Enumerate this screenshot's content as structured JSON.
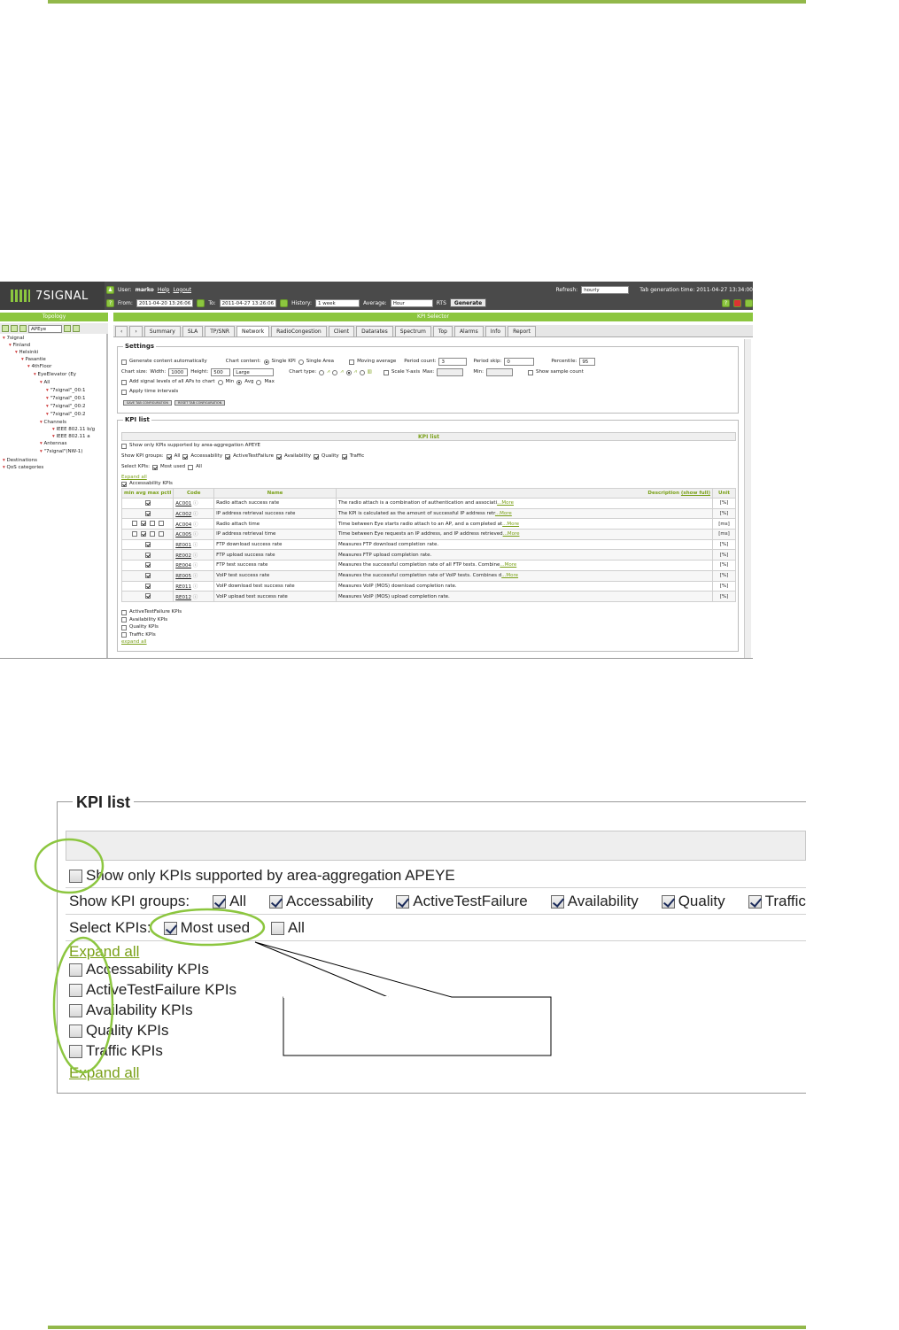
{
  "app": {
    "brand": "7SIGNAL",
    "user_label": "User:",
    "user_name": "marko",
    "help": "Help",
    "logout": "Logout",
    "refresh_label": "Refresh:",
    "refresh_value": "hourly",
    "tab_gen_time": "Tab generation time: 2011-04-27 13:34:00",
    "from_label": "From:",
    "from_value": "2011-04-20 13:26:06",
    "to_label": "To:",
    "to_value": "2011-04-27 13:26:06",
    "history_label": "History:",
    "history_value": "1 week",
    "average_label": "Average:",
    "average_value": "Hour",
    "rts": "RTS",
    "generate": "Generate"
  },
  "topology": {
    "title": "Topology",
    "dropdown": "APEye",
    "nodes": [
      "7signal",
      "Finland",
      "Helsinki",
      "Pasantie",
      "4thFloor",
      "EyeElevator (Ey",
      "All",
      "\"7signal\"_00:1",
      "\"7signal\"_00:1",
      "\"7signal\"_00:2",
      "\"7signal\"_00:2",
      "Channels",
      "IEEE 802.11 b/g",
      "IEEE 802.11 a",
      "Antennas",
      "\"7signal\"(NW-1)",
      "Destinations",
      "QoS categories"
    ]
  },
  "kpi_selector": {
    "title": "KPI Selector",
    "tabs": [
      "Summary",
      "SLA",
      "TP/SNR",
      "Network",
      "RadioCongestion",
      "Client",
      "Datarates",
      "Spectrum",
      "Top",
      "Alarms",
      "Info",
      "Report"
    ],
    "active_tab": "Network"
  },
  "settings": {
    "legend": "Settings",
    "generate_auto": "Generate content automatically",
    "chart_content": "Chart content:",
    "single_kpi": "Single KPI",
    "single_area": "Single Area",
    "moving_avg": "Moving average",
    "period_count_label": "Period count:",
    "period_count": "3",
    "period_skip_label": "Period skip:",
    "period_skip": "0",
    "percentile_label": "Percentile:",
    "percentile": "95",
    "chart_size": "Chart size:",
    "width_label": "Width:",
    "width": "1000",
    "height_label": "Height:",
    "height": "500",
    "size": "Large",
    "chart_type": "Chart type:",
    "scale_y": "Scale Y-axis",
    "max_label": "Max:",
    "min_label": "Min:",
    "show_sample": "Show sample count",
    "add_signal": "Add signal levels of all APs to chart",
    "min": "Min",
    "avg": "Avg",
    "max": "Max",
    "apply_time": "Apply time intervals",
    "save_btn": "SAVE TAB CONFIGURATION",
    "reset_btn": "RESET TAB CONFIGURATION"
  },
  "kpi_list": {
    "legend": "KPI list",
    "header": "KPI list",
    "show_only": "Show only KPIs supported by area-aggregation APEYE",
    "groups_label": "Show KPI groups:",
    "groups": [
      "All",
      "Accessability",
      "ActiveTestFailure",
      "Availability",
      "Quality",
      "Traffic"
    ],
    "select_label": "Select KPIs:",
    "most_used": "Most used",
    "all": "All",
    "expand_all": "Expand all",
    "accessability_kpis": "Accessability KPIs",
    "columns": {
      "stats": "min avg max pctl",
      "code": "Code",
      "name": "Name",
      "description": "Description",
      "show_full": "(show full)",
      "unit": "Unit"
    },
    "rows": [
      {
        "code": "AC001",
        "name": "Radio attach success rate",
        "desc": "The radio attach is a combination of authentication and associati",
        "more": "...More",
        "unit": "[%]",
        "boxes": [
          false,
          true,
          false,
          false
        ],
        "single": true
      },
      {
        "code": "AC002",
        "name": "IP address retrieval success rate",
        "desc": "The KPI is calculated as the amount of successful IP address retr",
        "more": "...More",
        "unit": "[%]",
        "single": true
      },
      {
        "code": "AC004",
        "name": "Radio attach time",
        "desc": "Time between Eye starts radio attach to an AP, and a completed at",
        "more": "...More",
        "unit": "[ms]",
        "single": false
      },
      {
        "code": "AC005",
        "name": "IP address retrieval time",
        "desc": "Time between Eye requests an IP address, and IP address retrieved",
        "more": "...More",
        "unit": "[ms]",
        "single": false
      },
      {
        "code": "RE001",
        "name": "FTP download success rate",
        "desc": "Measures FTP download completion rate.",
        "more": "",
        "unit": "[%]",
        "single": true
      },
      {
        "code": "RE002",
        "name": "FTP upload success rate",
        "desc": "Measures FTP upload completion rate.",
        "more": "",
        "unit": "[%]",
        "single": true
      },
      {
        "code": "RE004",
        "name": "FTP test success rate",
        "desc": "Measures the successful completion rate of all FTP tests. Combine",
        "more": "...More",
        "unit": "[%]",
        "single": true
      },
      {
        "code": "RE005",
        "name": "VoIP test success rate",
        "desc": "Measures the successful completion rate of VoIP tests. Combines d",
        "more": "...More",
        "unit": "[%]",
        "single": true
      },
      {
        "code": "RE011",
        "name": "VoIP download test success rate",
        "desc": "Measures VoIP (MOS) download completion rate.",
        "more": "",
        "unit": "[%]",
        "single": true
      },
      {
        "code": "RE012",
        "name": "VoIP upload test success rate",
        "desc": "Measures VoIP (MOS) upload completion rate.",
        "more": "",
        "unit": "[%]",
        "single": true
      }
    ],
    "other_groups": [
      "ActiveTestFailure KPIs",
      "Availability KPIs",
      "Quality KPIs",
      "Traffic KPIs"
    ],
    "expand_all_bottom": "expand all"
  },
  "zoom": {
    "legend": "KPI list",
    "show_only": "Show only KPIs supported by area-aggregation APEYE",
    "groups_label": "Show KPI groups:",
    "groups": [
      "All",
      "Accessability",
      "ActiveTestFailure",
      "Availability",
      "Quality",
      "Traffic"
    ],
    "select_label": "Select KPIs:",
    "most_used": "Most used",
    "all": "All",
    "expand_all": "Expand all",
    "group_items": [
      "Accessability KPIs",
      "ActiveTestFailure KPIs",
      "Availability KPIs",
      "Quality KPIs",
      "Traffic KPIs"
    ],
    "expand_all_bottom": "Expand all"
  },
  "colors": {
    "accent": "#8cc63f",
    "link": "#7aa018",
    "rule": "#92b84a"
  }
}
